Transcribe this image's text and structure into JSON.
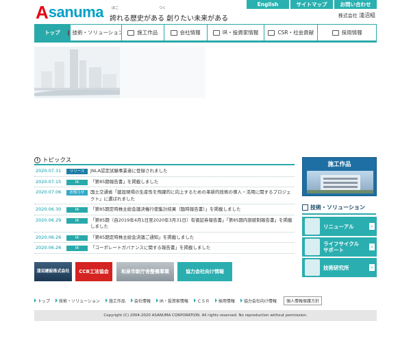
{
  "header": {
    "logo_a": "A",
    "logo_rest": "sanuma",
    "tagline_ruby_1": "ほこ",
    "tagline_ruby_2": "つく",
    "tagline": "誇れる歴史がある 創りたい未来がある",
    "company_prefix": "株式会社",
    "company_name": "淺沼組",
    "top_buttons": [
      "English",
      "サイトマップ",
      "お問い合わせ"
    ]
  },
  "nav": {
    "items": [
      "トップ",
      "技術・ソリューション",
      "施工作品",
      "会社情報",
      "IR・投資家情報",
      "CSR・社会貢献",
      "採用情報"
    ]
  },
  "topics": {
    "title": "トピックス",
    "info_glyph": "!",
    "rows": [
      {
        "date": "2020.07.31",
        "badge": "リリース",
        "badge_type": "release",
        "text": "JNLA認定試験事業者に登録されました"
      },
      {
        "date": "2020.07.15",
        "badge": "IR",
        "badge_type": "ir",
        "text": "「第85期報告書」を掲載しました"
      },
      {
        "date": "2020.07.06",
        "badge": "お知らせ",
        "badge_type": "notice",
        "text": "国土交通省「建設現場の生産性を飛躍的に向上するための革新的技術の導入・活用に関するプロジェクト」に選ばれました"
      },
      {
        "date": "2020.06.30",
        "badge": "IR",
        "badge_type": "ir",
        "text": "「第85期定時株主総会議決権行使集計結果（臨時報告書）」を掲載しました"
      },
      {
        "date": "2020.06.29",
        "badge": "IR",
        "badge_type": "ir",
        "text": "「第85期（自2019年4月1日至2020年3月31日）有価証券報告書」「第85期内部統制報告書」を掲載しました"
      },
      {
        "date": "2020.06.26",
        "badge": "IR",
        "badge_type": "ir",
        "text": "「第85期定時株主総会決議ご通知」を掲載しました"
      },
      {
        "date": "2020.06.26",
        "badge": "IR",
        "badge_type": "ir",
        "text": "「コーポレートガバナンスに関する報告書」を掲載しました"
      }
    ]
  },
  "banners": [
    "淺沼建設株式会社",
    "CCB工法協会",
    "和泉市新庁舎整備事業",
    "協力会社向け情報"
  ],
  "right": {
    "sekou": "施工作品",
    "sol_title": "技術・ソリューション",
    "arrow_glyph": "›",
    "buttons": [
      "リニューアル",
      "ライフサイクル サポート",
      "技術研究所"
    ]
  },
  "footer": {
    "links": [
      "トップ",
      "技術・ソリューション",
      "施工作品",
      "会社情報",
      "IR・投資家情報",
      "ＣＳＲ",
      "採用情報",
      "協力会社向け情報"
    ],
    "privacy": "個人情報保護方針",
    "copyright": "Copyright (C) 2004-2020 ASANUMA CORPORATION. All rights reserved. No reproduction without permission."
  }
}
